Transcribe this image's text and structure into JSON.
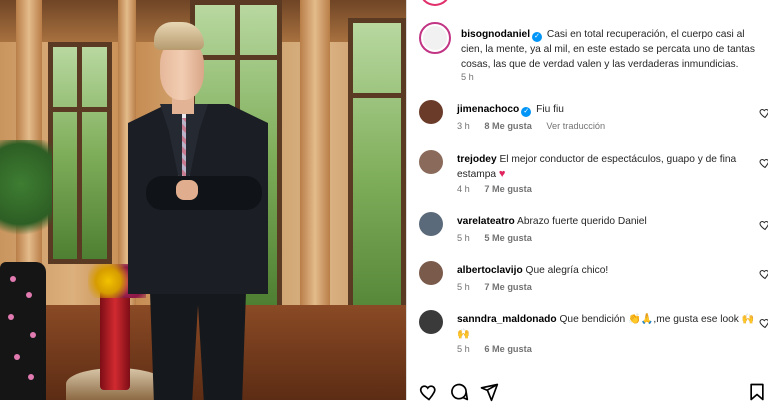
{
  "post": {
    "author": "bisognodaniel",
    "caption": "Casi en total recuperación, el cuerpo casi al cien, la mente, ya al mil, en este estado se percata uno de tantas cosas, las que de verdad valen y las verdaderas inmundicias.",
    "time": "5 h"
  },
  "comments": [
    {
      "user": "jimenachoco",
      "verified": true,
      "text": "Fiu fiu",
      "time": "3 h",
      "likes": "8 Me gusta",
      "translate": "Ver traducción",
      "avatar_color": "#6b3b2a"
    },
    {
      "user": "trejodey",
      "verified": false,
      "text": "El mejor conductor de espectáculos, guapo y de fina estampa",
      "emoji": "heart",
      "time": "4 h",
      "likes": "7 Me gusta",
      "avatar_color": "#8a6a5a"
    },
    {
      "user": "varelateatro",
      "verified": false,
      "text": "Abrazo fuerte querido Daniel",
      "time": "5 h",
      "likes": "5 Me gusta",
      "avatar_color": "#5a6a7a"
    },
    {
      "user": "albertoclavijo",
      "verified": false,
      "text": "Que alegría chico!",
      "time": "5 h",
      "likes": "7 Me gusta",
      "avatar_color": "#7a5a4a"
    },
    {
      "user": "sanndra_maldonado",
      "verified": false,
      "text": "Que bendición 👏🙏,me gusta ese look 🙌🙌",
      "time": "5 h",
      "likes": "6 Me gusta",
      "avatar_color": "#3a3a3a"
    }
  ],
  "icons": {
    "like": "heart-outline-icon",
    "comment": "comment-icon",
    "share": "paper-plane-icon",
    "save": "bookmark-icon",
    "verified": "verified-badge-icon"
  },
  "colors": {
    "verified": "#0095f6",
    "secondary_text": "#737373",
    "heart": "#e0245e"
  }
}
